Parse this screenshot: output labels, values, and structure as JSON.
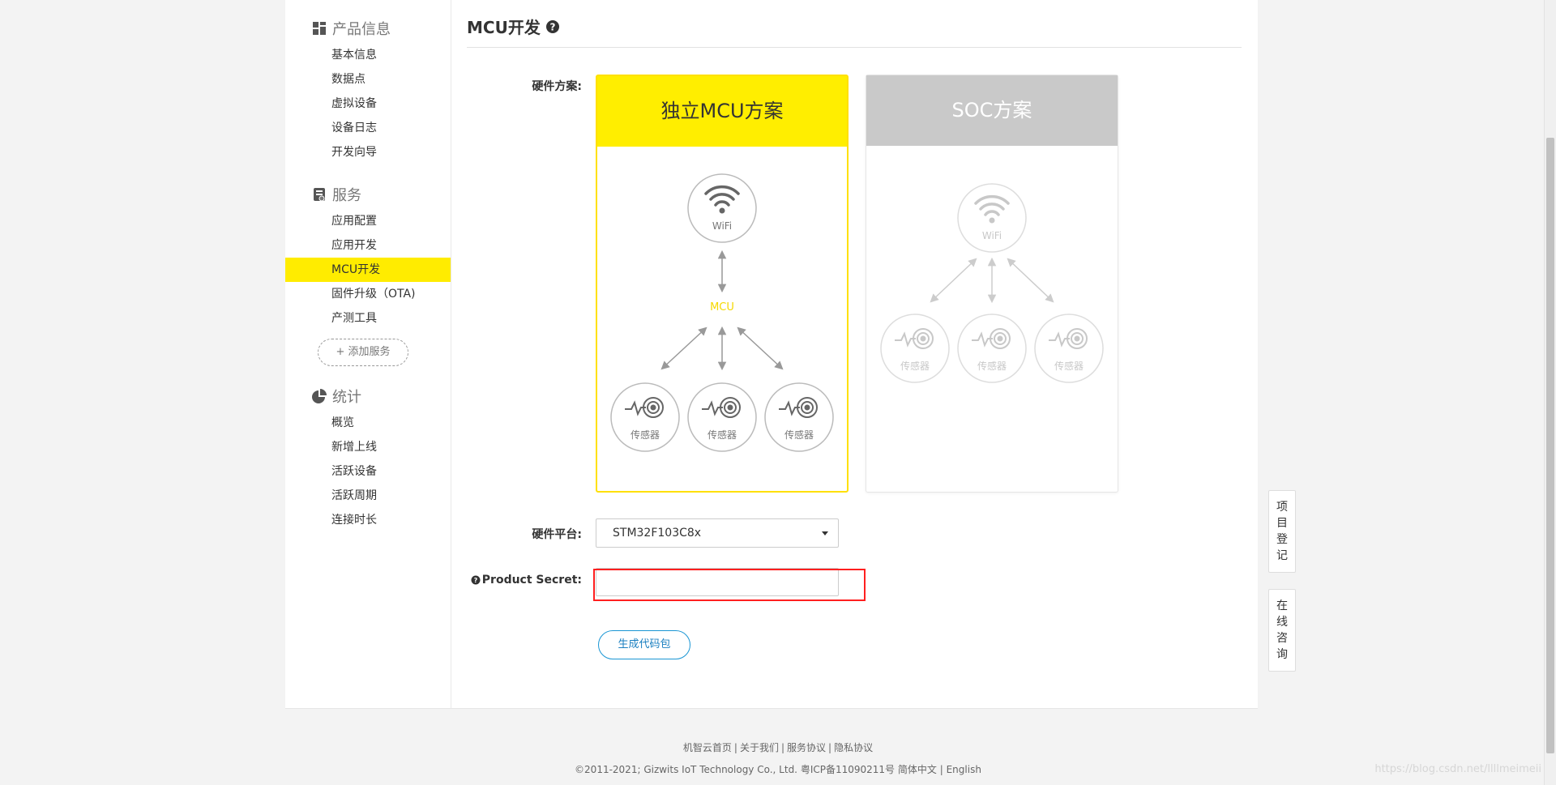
{
  "sidebar": {
    "groups": [
      {
        "title": "产品信息",
        "icon": "grid-icon",
        "items": [
          "基本信息",
          "数据点",
          "虚拟设备",
          "设备日志",
          "开发向导"
        ]
      },
      {
        "title": "服务",
        "icon": "service-icon",
        "items": [
          "应用配置",
          "应用开发",
          "MCU开发",
          "固件升级（OTA)",
          "产测工具"
        ],
        "active": "MCU开发",
        "add_label": "+ 添加服务"
      },
      {
        "title": "统计",
        "icon": "pie-chart-icon",
        "items": [
          "概览",
          "新增上线",
          "活跃设备",
          "活跃周期",
          "连接时长"
        ]
      }
    ]
  },
  "main": {
    "title": "MCU开发",
    "help_icon": "question-circle-icon",
    "hardware_label": "硬件方案:",
    "cards": {
      "mcu": {
        "header": "独立MCU方案",
        "wifi_label": "WiFi",
        "mcu_label": "MCU",
        "sensor_label": "传感器",
        "selected": true
      },
      "soc": {
        "header": "SOC方案",
        "wifi_label": "WiFi",
        "sensor_label": "传感器",
        "selected": false
      }
    },
    "platform_label": "硬件平台:",
    "platform_value": "STM32F103C8x",
    "secret_label": "Product Secret:",
    "secret_value": "",
    "generate_button": "生成代码包"
  },
  "floating": {
    "register": [
      "项",
      "目",
      "登",
      "记"
    ],
    "consult": [
      "在",
      "线",
      "咨",
      "询"
    ]
  },
  "footer": {
    "links": [
      "机智云首页",
      "关于我们",
      "服务协议",
      "隐私协议"
    ],
    "copyright": "©2011-2021; Gizwits IoT Technology Co., Ltd. 粤ICP备11090211号",
    "lang_zh": "简体中文",
    "lang_en": "English"
  },
  "watermark": "https://blog.csdn.net/llllmeimeii",
  "colors": {
    "accent_yellow": "#ffee00",
    "selected_border": "#ffe000",
    "soc_header": "#c9c9c9",
    "highlight_red": "#ff1f1f",
    "button_blue": "#1a96d4",
    "mcu_label": "#f5d800"
  }
}
